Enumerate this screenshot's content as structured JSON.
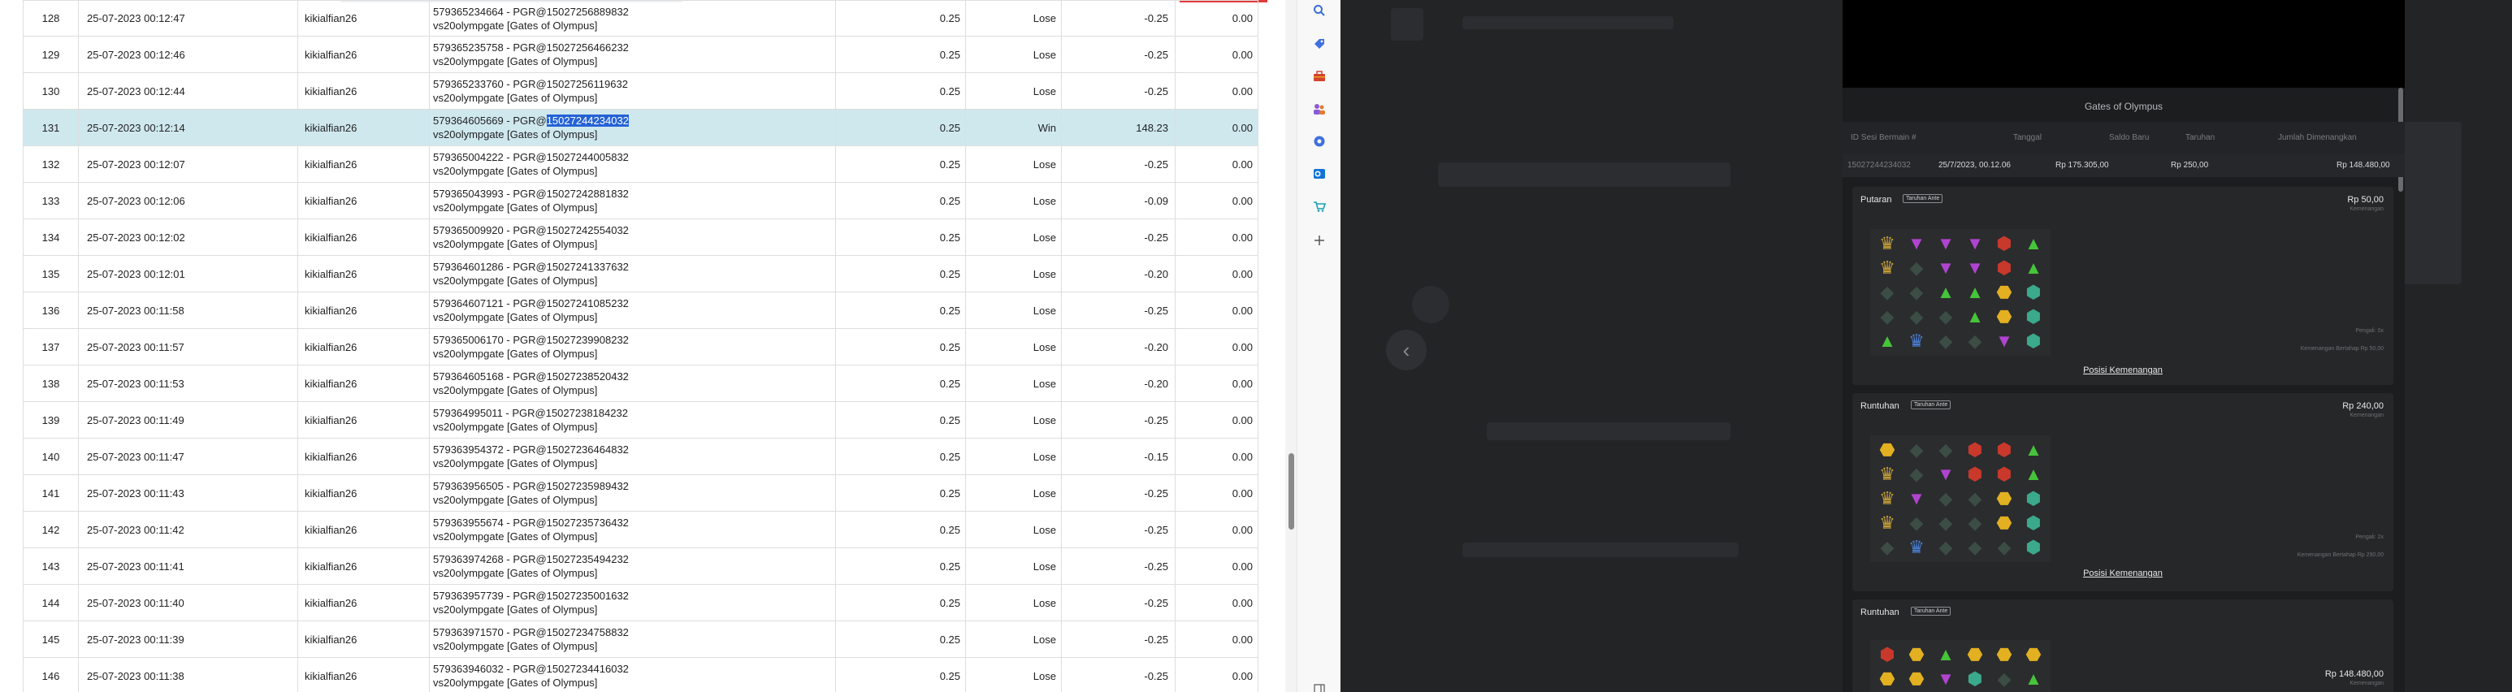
{
  "table": {
    "rows": [
      {
        "no": "128",
        "date": "25-07-2023 00:12:47",
        "user": "kikialfian26",
        "desc1": "579365234664 - PGR@15027256889832",
        "desc2": "vs20olympgate [Gates of Olympus]",
        "bet": "0.25",
        "result": "Lose",
        "amount": "-0.25",
        "balance": "0.00"
      },
      {
        "no": "129",
        "date": "25-07-2023 00:12:46",
        "user": "kikialfian26",
        "desc1": "579365235758 - PGR@15027256466232",
        "desc2": "vs20olympgate [Gates of Olympus]",
        "bet": "0.25",
        "result": "Lose",
        "amount": "-0.25",
        "balance": "0.00"
      },
      {
        "no": "130",
        "date": "25-07-2023 00:12:44",
        "user": "kikialfian26",
        "desc1": "579365233760 - PGR@15027256119632",
        "desc2": "vs20olympgate [Gates of Olympus]",
        "bet": "0.25",
        "result": "Lose",
        "amount": "-0.25",
        "balance": "0.00"
      },
      {
        "no": "131",
        "date": "25-07-2023 00:12:14",
        "user": "kikialfian26",
        "desc1": "579364605669 - PGR@",
        "desc1_sel": "15027244234032",
        "desc2": "vs20olympgate [Gates of Olympus]",
        "bet": "0.25",
        "result": "Win",
        "amount": "148.23",
        "balance": "0.00",
        "highlight": true
      },
      {
        "no": "132",
        "date": "25-07-2023 00:12:07",
        "user": "kikialfian26",
        "desc1": "579365004222 - PGR@15027244005832",
        "desc2": "vs20olympgate [Gates of Olympus]",
        "bet": "0.25",
        "result": "Lose",
        "amount": "-0.25",
        "balance": "0.00"
      },
      {
        "no": "133",
        "date": "25-07-2023 00:12:06",
        "user": "kikialfian26",
        "desc1": "579365043993 - PGR@15027242881832",
        "desc2": "vs20olympgate [Gates of Olympus]",
        "bet": "0.25",
        "result": "Lose",
        "amount": "-0.09",
        "balance": "0.00"
      },
      {
        "no": "134",
        "date": "25-07-2023 00:12:02",
        "user": "kikialfian26",
        "desc1": "579365009920 - PGR@15027242554032",
        "desc2": "vs20olympgate [Gates of Olympus]",
        "bet": "0.25",
        "result": "Lose",
        "amount": "-0.25",
        "balance": "0.00"
      },
      {
        "no": "135",
        "date": "25-07-2023 00:12:01",
        "user": "kikialfian26",
        "desc1": "579364601286 - PGR@15027241337632",
        "desc2": "vs20olympgate [Gates of Olympus]",
        "bet": "0.25",
        "result": "Lose",
        "amount": "-0.20",
        "balance": "0.00"
      },
      {
        "no": "136",
        "date": "25-07-2023 00:11:58",
        "user": "kikialfian26",
        "desc1": "579364607121 - PGR@15027241085232",
        "desc2": "vs20olympgate [Gates of Olympus]",
        "bet": "0.25",
        "result": "Lose",
        "amount": "-0.25",
        "balance": "0.00"
      },
      {
        "no": "137",
        "date": "25-07-2023 00:11:57",
        "user": "kikialfian26",
        "desc1": "579365006170 - PGR@15027239908232",
        "desc2": "vs20olympgate [Gates of Olympus]",
        "bet": "0.25",
        "result": "Lose",
        "amount": "-0.20",
        "balance": "0.00"
      },
      {
        "no": "138",
        "date": "25-07-2023 00:11:53",
        "user": "kikialfian26",
        "desc1": "579364605168 - PGR@15027238520432",
        "desc2": "vs20olympgate [Gates of Olympus]",
        "bet": "0.25",
        "result": "Lose",
        "amount": "-0.20",
        "balance": "0.00"
      },
      {
        "no": "139",
        "date": "25-07-2023 00:11:49",
        "user": "kikialfian26",
        "desc1": "579364995011 - PGR@15027238184232",
        "desc2": "vs20olympgate [Gates of Olympus]",
        "bet": "0.25",
        "result": "Lose",
        "amount": "-0.25",
        "balance": "0.00"
      },
      {
        "no": "140",
        "date": "25-07-2023 00:11:47",
        "user": "kikialfian26",
        "desc1": "579363954372 - PGR@15027236464832",
        "desc2": "vs20olympgate [Gates of Olympus]",
        "bet": "0.25",
        "result": "Lose",
        "amount": "-0.15",
        "balance": "0.00"
      },
      {
        "no": "141",
        "date": "25-07-2023 00:11:43",
        "user": "kikialfian26",
        "desc1": "579363956505 - PGR@15027235989432",
        "desc2": "vs20olympgate [Gates of Olympus]",
        "bet": "0.25",
        "result": "Lose",
        "amount": "-0.25",
        "balance": "0.00"
      },
      {
        "no": "142",
        "date": "25-07-2023 00:11:42",
        "user": "kikialfian26",
        "desc1": "579363955674 - PGR@15027235736432",
        "desc2": "vs20olympgate [Gates of Olympus]",
        "bet": "0.25",
        "result": "Lose",
        "amount": "-0.25",
        "balance": "0.00"
      },
      {
        "no": "143",
        "date": "25-07-2023 00:11:41",
        "user": "kikialfian26",
        "desc1": "579363974268 - PGR@15027235494232",
        "desc2": "vs20olympgate [Gates of Olympus]",
        "bet": "0.25",
        "result": "Lose",
        "amount": "-0.25",
        "balance": "0.00"
      },
      {
        "no": "144",
        "date": "25-07-2023 00:11:40",
        "user": "kikialfian26",
        "desc1": "579363957739 - PGR@15027235001632",
        "desc2": "vs20olympgate [Gates of Olympus]",
        "bet": "0.25",
        "result": "Lose",
        "amount": "-0.25",
        "balance": "0.00"
      },
      {
        "no": "145",
        "date": "25-07-2023 00:11:39",
        "user": "kikialfian26",
        "desc1": "579363971570 - PGR@15027234758832",
        "desc2": "vs20olympgate [Gates of Olympus]",
        "bet": "0.25",
        "result": "Lose",
        "amount": "-0.25",
        "balance": "0.00"
      },
      {
        "no": "146",
        "date": "25-07-2023 00:11:38",
        "user": "kikialfian26",
        "desc1": "579363946032 - PGR@15027234416032",
        "desc2": "vs20olympgate [Gates of Olympus]",
        "bet": "0.25",
        "result": "Lose",
        "amount": "-0.25",
        "balance": "0.00"
      }
    ]
  },
  "side_strip": {
    "icons": [
      "search-icon",
      "tag-icon",
      "toolbox-icon",
      "people-icon",
      "gear-circle-icon",
      "outlook-icon",
      "cart-icon",
      "plus-icon",
      "sidebar-toggle-icon"
    ]
  },
  "game": {
    "title": "Gates of Olympus",
    "summary_headers": [
      "ID Sesi Bermain #",
      "Tanggal",
      "Saldo Baru",
      "Taruhan",
      "Jumlah Dimenangkan"
    ],
    "summary_row": [
      "15027244234032",
      "25/7/2023, 00.12.06",
      "Rp 175.305,00",
      "Rp 250,00",
      "Rp 148.480,00"
    ],
    "rounds": [
      {
        "title": "Putaran",
        "tag": "Taruhan Ante",
        "amount": "Rp 50,00",
        "sub": "Kemenangan",
        "notes": [
          "Pengali: 0x",
          "Kemenangan Bertahap Rp 50,00"
        ],
        "link": "Posisi Kemenangan"
      },
      {
        "title": "Runtuhan",
        "tag": "Taruhan Ante",
        "amount": "Rp 240,00",
        "sub": "Kemenangan",
        "notes": [
          "Pengali: 2x",
          "Kemenangan Bertahap Rp 290,00"
        ],
        "link": "Posisi Kemenangan"
      },
      {
        "title": "Runtuhan",
        "tag": "Taruhan Ante",
        "amount": "Rp 148.480,00",
        "sub": "Kemenangan",
        "notes": [],
        "link": ""
      }
    ],
    "grid1": [
      [
        "crown",
        "tri-purple",
        "tri-purple",
        "tri-purple",
        "gem-red",
        "tri-green"
      ],
      [
        "crown",
        "diamond-dark",
        "tri-purple",
        "tri-purple",
        "gem-red",
        "tri-green"
      ],
      [
        "diamond-dark",
        "diamond-dark",
        "tri-green",
        "tri-green",
        "ring-gold",
        "gem-teal"
      ],
      [
        "diamond-dark",
        "diamond-dark",
        "diamond-dark",
        "tri-green",
        "ring-gold",
        "gem-teal"
      ],
      [
        "tri-green",
        "crown-blue",
        "diamond-dark",
        "diamond-dark",
        "tri-purple",
        "gem-teal"
      ]
    ],
    "grid2": [
      [
        "ring-gold",
        "diamond-dark",
        "diamond-dark",
        "gem-red",
        "gem-red",
        "tri-green"
      ],
      [
        "crown",
        "diamond-dark",
        "tri-purple",
        "gem-red",
        "gem-red",
        "tri-green"
      ],
      [
        "crown",
        "tri-purple",
        "diamond-dark",
        "diamond-dark",
        "ring-gold",
        "gem-teal"
      ],
      [
        "crown",
        "diamond-dark",
        "diamond-dark",
        "diamond-dark",
        "ring-gold",
        "gem-teal"
      ],
      [
        "diamond-dark",
        "crown-blue",
        "diamond-dark",
        "diamond-dark",
        "diamond-dark",
        "gem-teal"
      ]
    ],
    "grid3": [
      [
        "gem-red",
        "ring-gold",
        "tri-green",
        "ring-gold",
        "ring-gold",
        "ring-gold"
      ],
      [
        "ring-gold",
        "ring-gold",
        "tri-purple",
        "gem-teal",
        "diamond-dark",
        "tri-green"
      ]
    ]
  },
  "colors": {
    "lose": "#e02020",
    "win": "#1e9a3a",
    "highlight": "#cfe8ee",
    "selection": "#2463d6",
    "dark_bg": "#232426",
    "panel_bg": "#1c1d1f"
  }
}
